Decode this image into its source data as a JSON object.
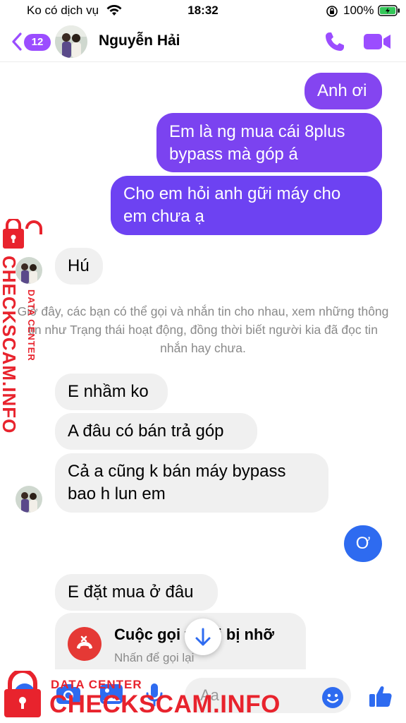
{
  "status_bar": {
    "carrier": "Ko có dịch vụ",
    "time": "18:32",
    "battery": "100%"
  },
  "header": {
    "back_count": "12",
    "contact_name": "Nguyễn Hải"
  },
  "colors": {
    "accent": "#9b4dff",
    "outgoing_top": "#7b3ff0",
    "outgoing_blue": "#2e6bf0",
    "incoming_bg": "#f0f0f0",
    "missed_call": "#e53935",
    "watermark": "#e8232d"
  },
  "messages": [
    {
      "id": "m1",
      "direction": "outgoing",
      "lines": [
        "Anh ơi"
      ]
    },
    {
      "id": "m2",
      "direction": "outgoing",
      "lines": [
        "Em là ng mua cái 8plus",
        "bypass mà góp á"
      ]
    },
    {
      "id": "m3",
      "direction": "outgoing",
      "lines": [
        "Cho em hỏi anh gữi máy cho",
        "em chưa ạ"
      ]
    },
    {
      "id": "m4",
      "direction": "incoming",
      "lines": [
        "Hú"
      ]
    },
    {
      "id": "m5",
      "direction": "incoming",
      "lines": [
        "E nhầm ko"
      ]
    },
    {
      "id": "m6",
      "direction": "incoming",
      "lines": [
        "A đâu có bán trả góp"
      ]
    },
    {
      "id": "m7",
      "direction": "incoming",
      "lines": [
        "Cả a cũng k bán máy bypass",
        "bao h lun em"
      ]
    },
    {
      "id": "m8",
      "direction": "outgoing",
      "lines": [
        "Ơ"
      ]
    },
    {
      "id": "m9",
      "direction": "incoming",
      "lines": [
        "E đặt mua ở đâu"
      ]
    }
  ],
  "info_notice": "Giờ đây, các bạn có thể gọi và nhắn tin cho nhau, xem những thông tin như Trạng thái hoạt động, đồng thời biết người kia đã đọc tin nhắn hay chưa.",
  "missed_call": {
    "title": "Cuộc gọi thoại bị nhỡ",
    "subtitle": "Nhấn để gọi lại"
  },
  "composer": {
    "placeholder": "Aa"
  },
  "icons": {
    "back": "chevron-left-icon",
    "call": "phone-icon",
    "video": "video-camera-icon",
    "more": "grid-dots-icon",
    "camera": "camera-icon",
    "gallery": "image-icon",
    "mic": "microphone-icon",
    "emoji": "smile-icon",
    "like": "thumbs-up-icon",
    "scroll_down": "arrow-down-icon",
    "missed_call": "missed-call-icon"
  },
  "watermark": {
    "label": "DATA CENTER",
    "site": "CHECKSCAM.INFO"
  }
}
